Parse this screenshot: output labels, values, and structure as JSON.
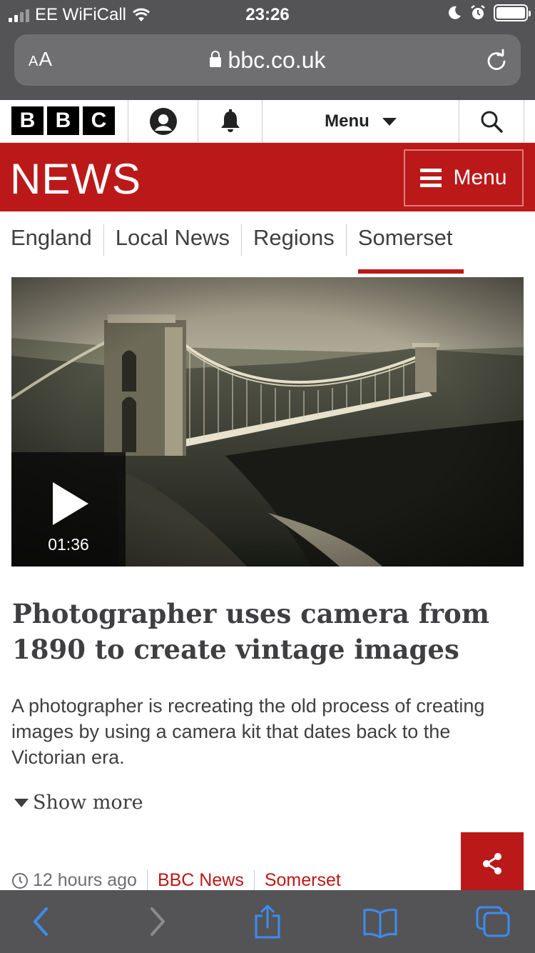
{
  "status_bar": {
    "carrier": "EE WiFiCall",
    "time": "23:26"
  },
  "browser": {
    "text_size": "AA",
    "url": "bbc.co.uk"
  },
  "masthead": {
    "bbc_letters": [
      "B",
      "B",
      "C"
    ],
    "menu_label": "Menu"
  },
  "news": {
    "logo": "NEWS",
    "menu_label": "Menu"
  },
  "nav": {
    "items": [
      "England",
      "Local News",
      "Regions",
      "Somerset"
    ],
    "active": "Somerset"
  },
  "media": {
    "duration": "01:36"
  },
  "article": {
    "headline": "Photographer uses camera from 1890 to create vintage images",
    "summary": "A photographer is recreating the old process of creating images by using a camera kit that dates back to the Victorian era.",
    "show_more": "Show more",
    "time_ago": "12 hours ago",
    "source": "BBC News",
    "topic": "Somerset"
  },
  "colors": {
    "bbc_red": "#bb1919",
    "ios_chrome": "#545456",
    "ios_blue": "#3d8bf2"
  }
}
